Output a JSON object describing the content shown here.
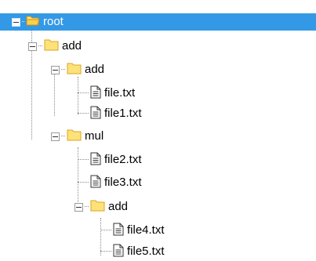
{
  "tree": {
    "root_label": "root",
    "nodes": [
      {
        "label": "add",
        "type": "folder"
      },
      {
        "label": "add",
        "type": "folder"
      },
      {
        "label": "file.txt",
        "type": "file"
      },
      {
        "label": "file1.txt",
        "type": "file"
      },
      {
        "label": "mul",
        "type": "folder"
      },
      {
        "label": "file2.txt",
        "type": "file"
      },
      {
        "label": "file3.txt",
        "type": "file"
      },
      {
        "label": "add",
        "type": "folder"
      },
      {
        "label": "file4.txt",
        "type": "file"
      },
      {
        "label": "file5.txt",
        "type": "file"
      }
    ]
  },
  "colors": {
    "selection": "#3399e6",
    "folder_fill": "#fde27a",
    "folder_stroke": "#d9a520"
  }
}
